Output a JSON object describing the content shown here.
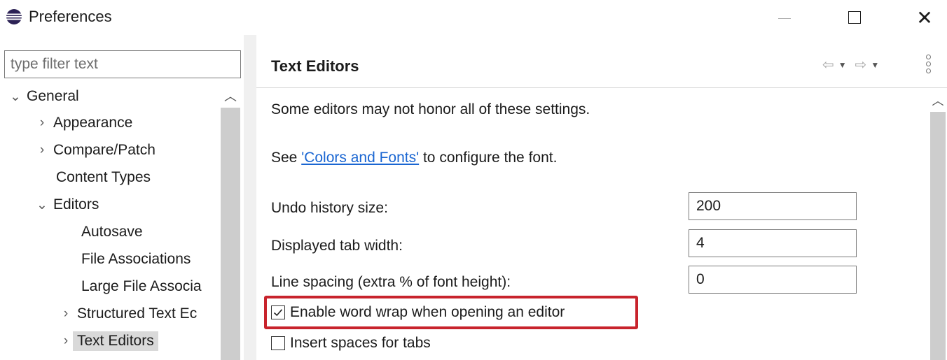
{
  "window": {
    "title": "Preferences",
    "icon": "eclipse-icon"
  },
  "sidebar": {
    "filter_placeholder": "type filter text",
    "tree": [
      {
        "label": "General",
        "expander": "⌄",
        "level": 0
      },
      {
        "label": "Appearance",
        "expander": "›",
        "level": 1
      },
      {
        "label": "Compare/Patch",
        "expander": "›",
        "level": 1
      },
      {
        "label": "Content Types",
        "expander": "",
        "level": 1
      },
      {
        "label": "Editors",
        "expander": "⌄",
        "level": 1
      },
      {
        "label": "Autosave",
        "expander": "",
        "level": 2
      },
      {
        "label": "File Associations",
        "expander": "",
        "level": 2
      },
      {
        "label": "Large File Associa",
        "expander": "",
        "level": 2
      },
      {
        "label": "Structured Text Ec",
        "expander": "›",
        "level": 2
      },
      {
        "label": "Text Editors",
        "expander": "›",
        "level": 2,
        "selected": true
      }
    ]
  },
  "page": {
    "title": "Text Editors",
    "intro": "Some editors may not honor all of these settings.",
    "see_prefix": "See ",
    "see_link": "'Colors and Fonts'",
    "see_suffix": " to configure the font.",
    "fields": {
      "undo_label": "Undo history size:",
      "undo_value": "200",
      "tab_width_label": "Displayed tab width:",
      "tab_width_value": "4",
      "line_spacing_label": "Line spacing (extra % of font height):",
      "line_spacing_value": "0"
    },
    "checkboxes": {
      "word_wrap_label": "Enable word wrap when opening an editor",
      "word_wrap_checked": true,
      "insert_spaces_label": "Insert spaces for tabs",
      "insert_spaces_checked": false
    }
  },
  "colors": {
    "highlight": "#c8232c",
    "link": "#1a66d2",
    "selection": "#d9d9d9"
  }
}
